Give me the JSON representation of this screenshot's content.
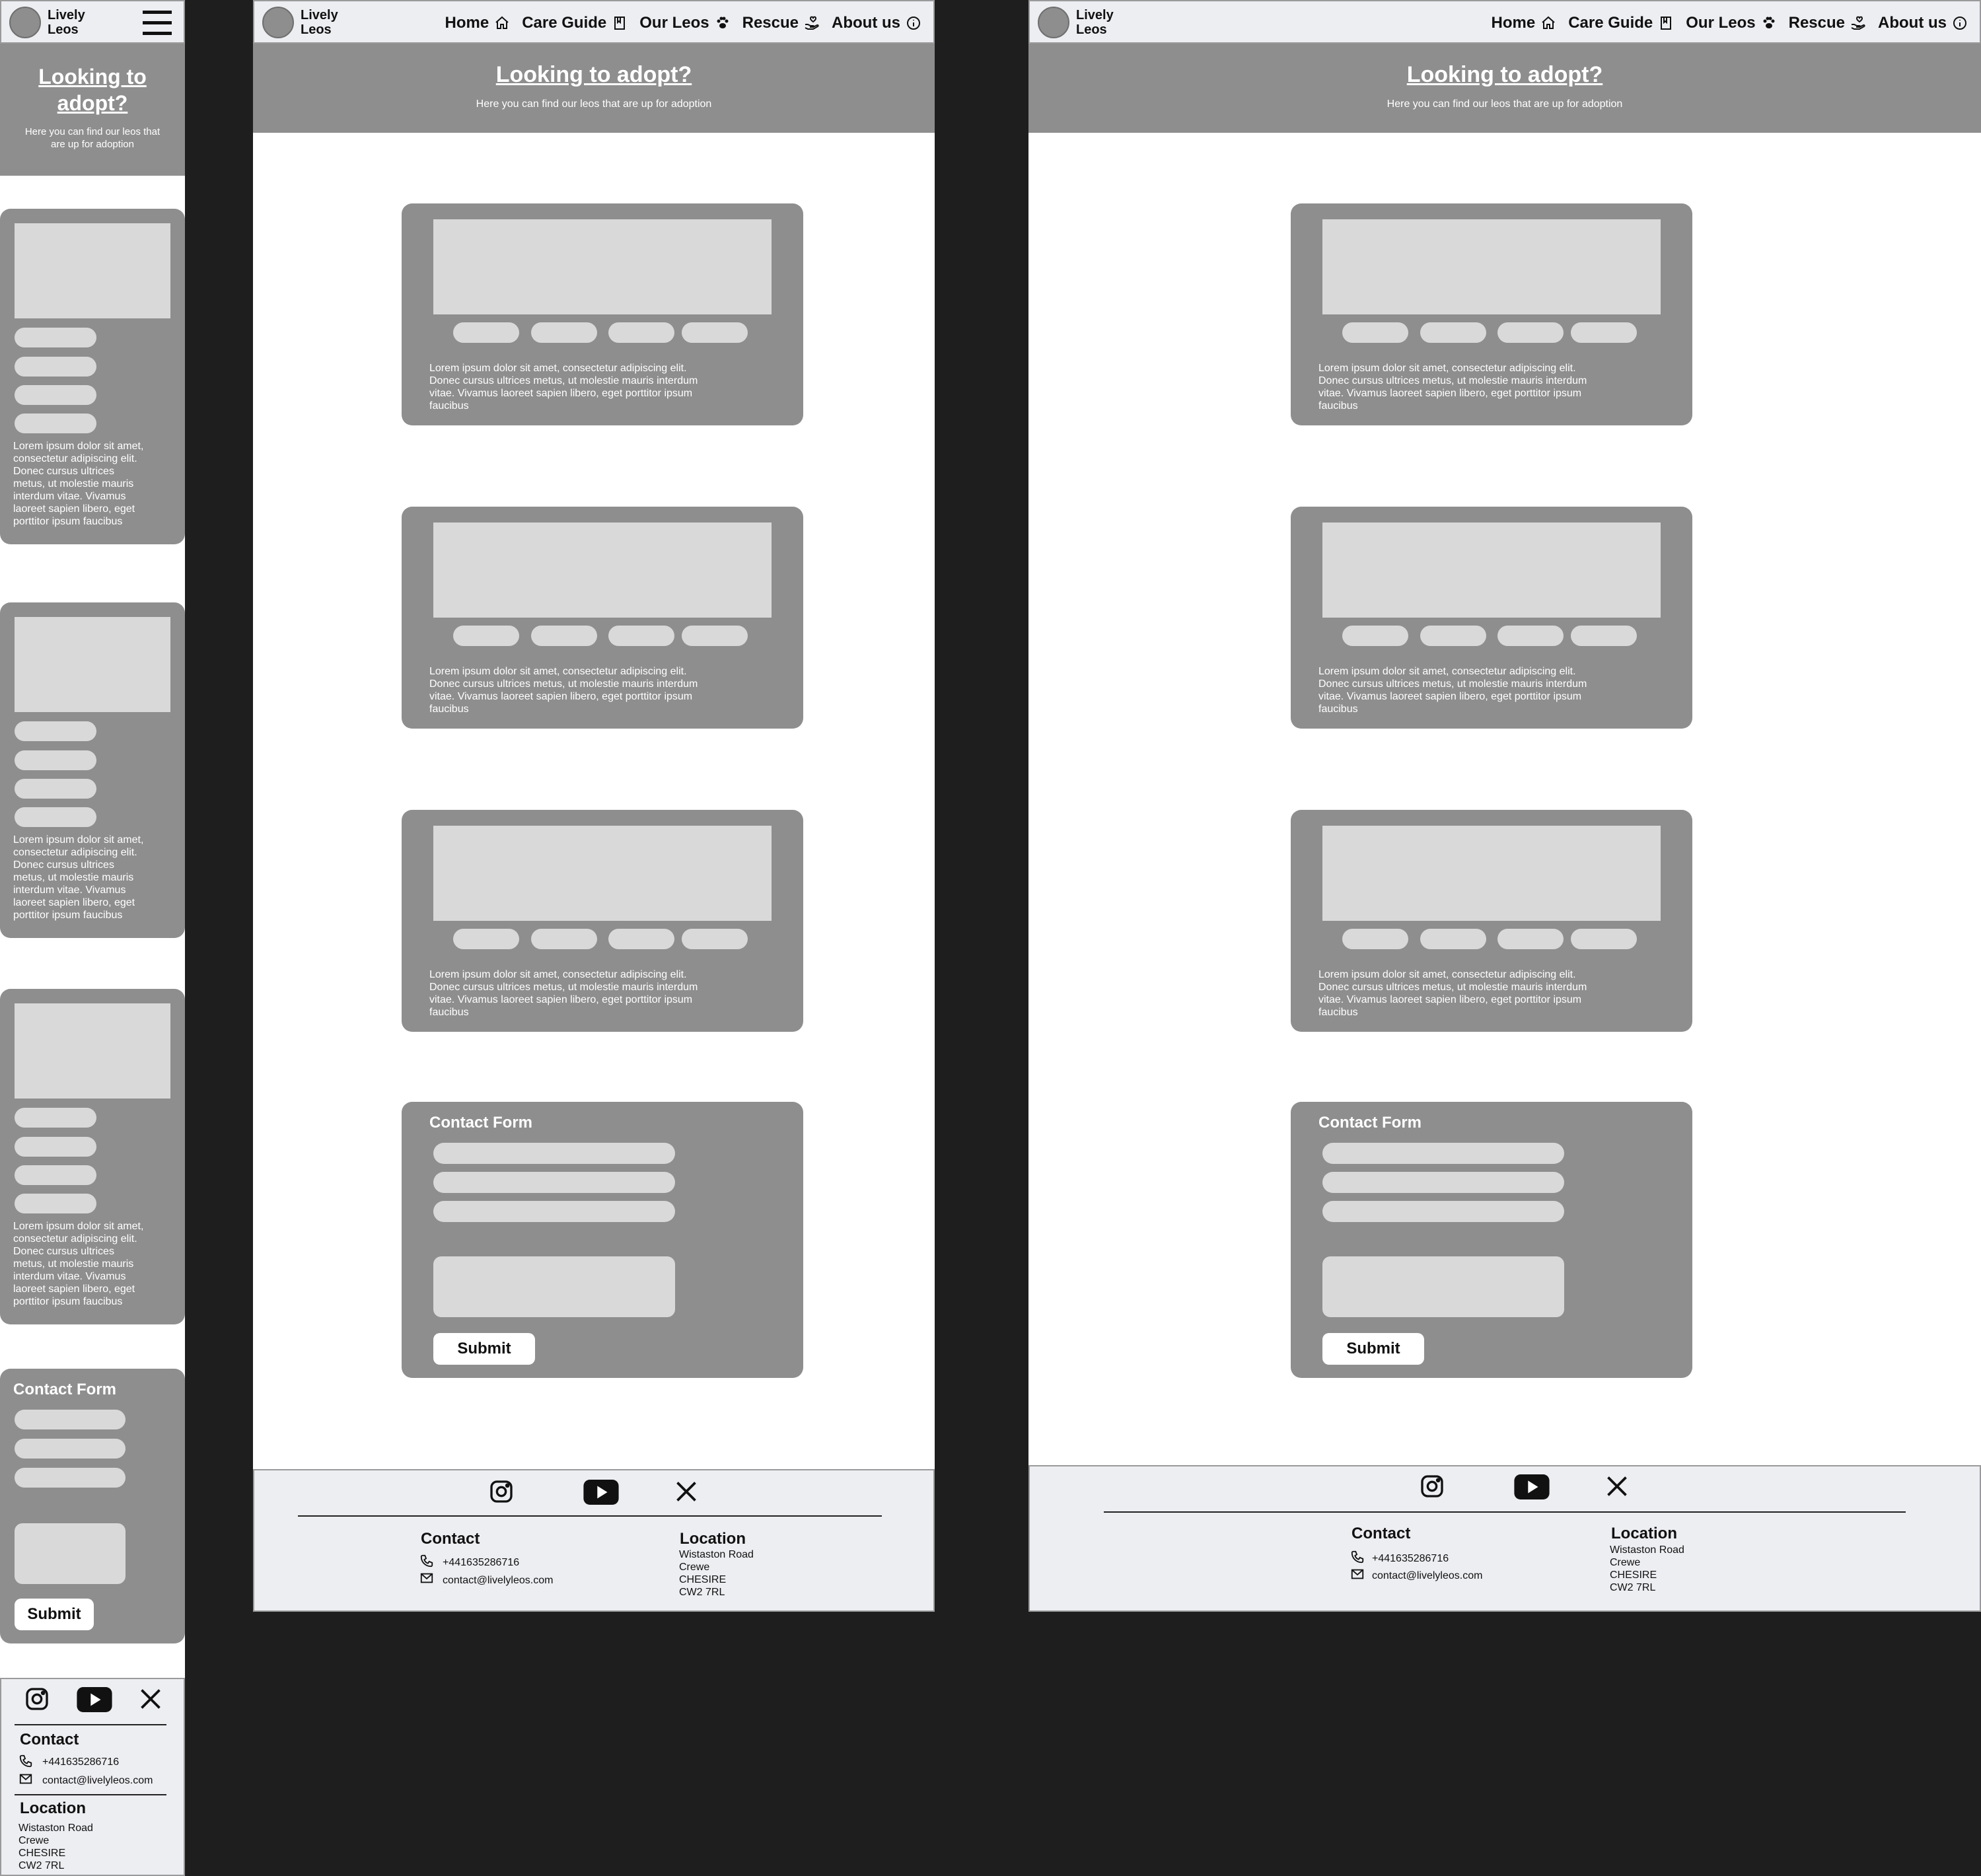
{
  "logo": {
    "line1": "Lively",
    "line2": "Leos"
  },
  "nav": {
    "home": "Home",
    "care_guide": "Care Guide",
    "our_leos": "Our Leos",
    "rescue": "Rescue",
    "about": "About us"
  },
  "hero": {
    "title": "Looking to adopt?",
    "title_mobile_1": "Looking to",
    "title_mobile_2": "adopt?",
    "subtitle": "Here you can find our leos that are up for adoption",
    "subtitle_mobile_1": "Here you can find our leos that",
    "subtitle_mobile_2": "are up for adoption"
  },
  "card": {
    "text_wide": [
      "Lorem ipsum dolor sit amet, consectetur adipiscing elit.",
      "Donec cursus ultrices metus, ut molestie mauris interdum",
      "vitae. Vivamus laoreet sapien libero, eget porttitor ipsum",
      "faucibus"
    ],
    "text_narrow": [
      "Lorem ipsum dolor sit amet,",
      "consectetur adipiscing elit.",
      "Donec cursus ultrices",
      "metus, ut molestie mauris",
      "interdum vitae. Vivamus",
      "laoreet sapien libero, eget",
      "porttitor ipsum faucibus"
    ]
  },
  "contact_form": {
    "title": "Contact Form",
    "submit": "Submit"
  },
  "footer": {
    "contact_heading": "Contact",
    "phone": "+441635286716",
    "email": "contact@livelyleos.com",
    "location_heading": "Location",
    "address": [
      "Wistaston Road",
      "Crewe",
      "CHESIRE",
      "CW2 7RL"
    ]
  },
  "icons": [
    "instagram-icon",
    "youtube-icon",
    "x-icon",
    "home-icon",
    "book-icon",
    "paw-icon",
    "hand-heart-icon",
    "info-icon",
    "phone-icon",
    "mail-icon",
    "hamburger-icon"
  ],
  "colors": {
    "card": "#8e8e8e",
    "placeholder": "#d9d9d9",
    "navbar": "#edeef2",
    "background": "#1e1e1e"
  }
}
